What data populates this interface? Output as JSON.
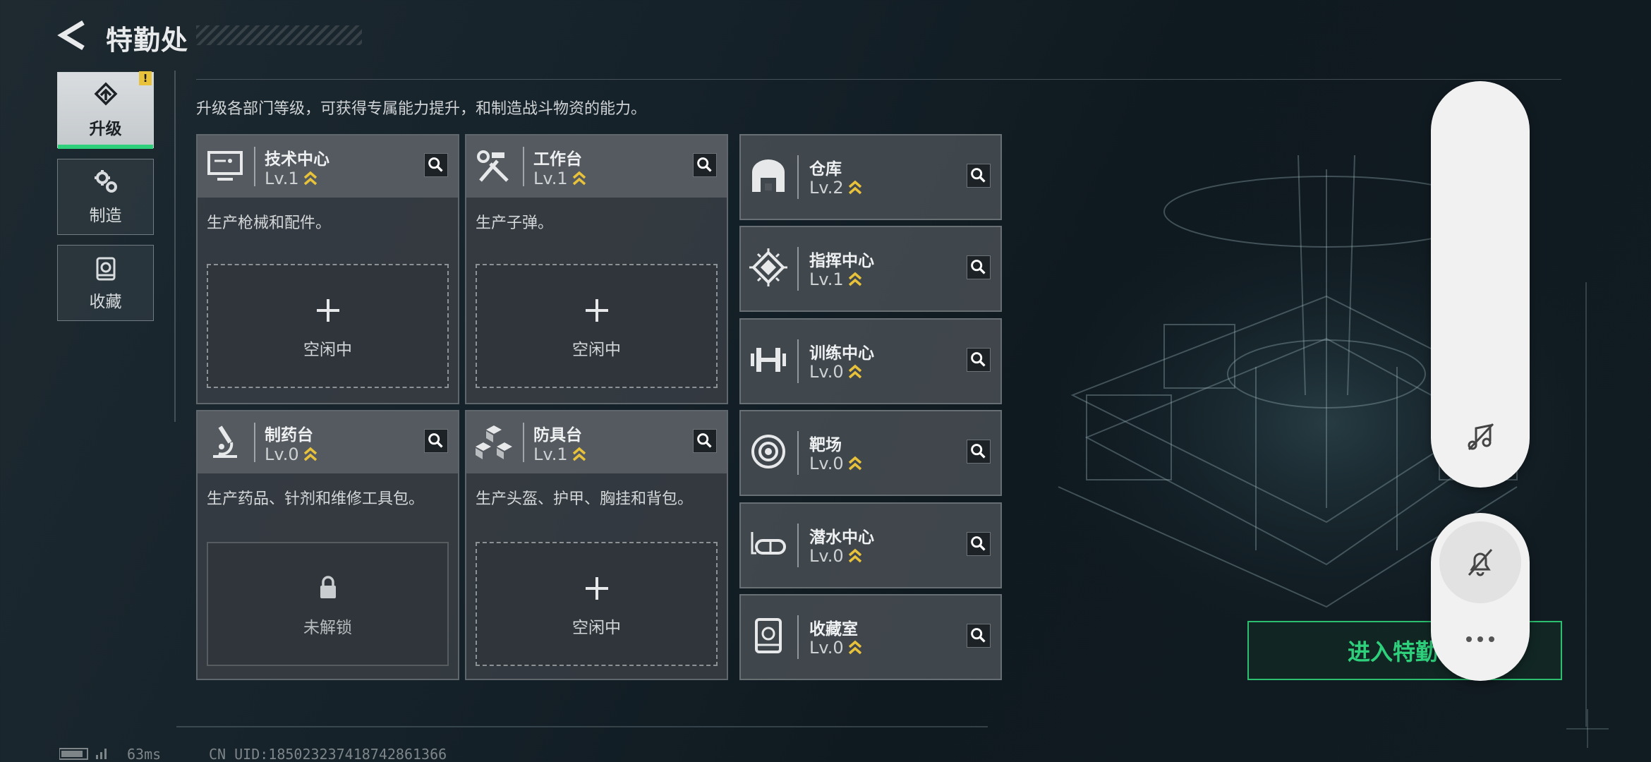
{
  "header": {
    "title": "特勤处"
  },
  "sidebar": {
    "tabs": [
      {
        "label": "升级",
        "icon": "upgrade-icon",
        "active": true,
        "badge": "!"
      },
      {
        "label": "制造",
        "icon": "gears-icon",
        "active": false
      },
      {
        "label": "收藏",
        "icon": "collection-icon",
        "active": false
      }
    ]
  },
  "main": {
    "description": "升级各部门等级，可获得专属能力提升，和制造战斗物资的能力。",
    "workstations": [
      {
        "name": "技术中心",
        "level": "Lv.1",
        "icon": "computer-icon",
        "desc": "生产枪械和配件。",
        "slot_status": "空闲中",
        "slot_icon": "plus-icon"
      },
      {
        "name": "工作台",
        "level": "Lv.1",
        "icon": "tools-icon",
        "desc": "生产子弹。",
        "slot_status": "空闲中",
        "slot_icon": "plus-icon"
      },
      {
        "name": "制药台",
        "level": "Lv.0",
        "icon": "microscope-icon",
        "desc": "生产药品、针剂和维修工具包。",
        "slot_status": "未解锁",
        "slot_icon": "lock-icon"
      },
      {
        "name": "防具台",
        "level": "Lv.1",
        "icon": "armor-cubes-icon",
        "desc": "生产头盔、护甲、胸挂和背包。",
        "slot_status": "空闲中",
        "slot_icon": "plus-icon"
      }
    ],
    "facilities": [
      {
        "name": "仓库",
        "level": "Lv.2",
        "icon": "warehouse-icon"
      },
      {
        "name": "指挥中心",
        "level": "Lv.1",
        "icon": "chip-icon"
      },
      {
        "name": "训练中心",
        "level": "Lv.0",
        "icon": "dumbbell-icon"
      },
      {
        "name": "靶场",
        "level": "Lv.0",
        "icon": "target-icon"
      },
      {
        "name": "潜水中心",
        "level": "Lv.0",
        "icon": "diving-mask-icon"
      },
      {
        "name": "收藏室",
        "level": "Lv.0",
        "icon": "collection-icon"
      }
    ],
    "enter_button": "进入特勤"
  },
  "status_bar": {
    "ping": "63ms",
    "uid": "CN UID:1850232374187428613​66"
  },
  "overlay": {
    "icons": [
      "music-off-icon",
      "bell-off-icon",
      "more-icon"
    ]
  },
  "colors": {
    "accent_green": "#2fd07c",
    "upgrade_gold": "#e8c23a",
    "badge_yellow": "#e8c23a"
  }
}
